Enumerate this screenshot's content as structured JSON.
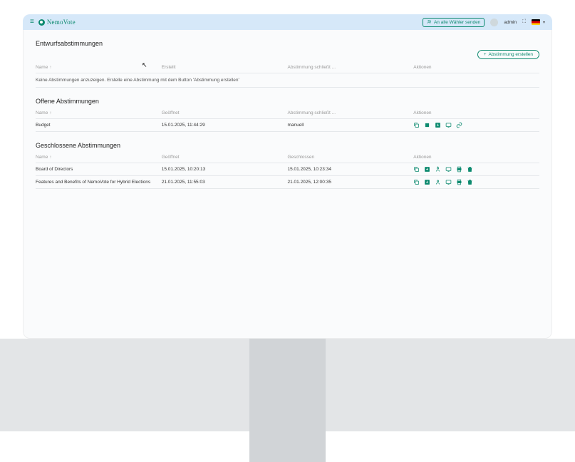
{
  "header": {
    "brand": "NemoVote",
    "broadcast_label": "An alle Wähler senden",
    "admin_label": "admin"
  },
  "cursor": "↖",
  "sections": {
    "drafts": {
      "title": "Entwurfsabstimmungen",
      "create_label": "Abstimmung erstellen",
      "cols": {
        "name": "Name",
        "created": "Erstellt",
        "closes": "Abstimmung schließt ...",
        "actions": "Aktionen"
      },
      "empty": "Keine Abstimmungen anzuzeigen. Erstelle eine Abstimmung mit dem Button 'Abstimmung erstellen'"
    },
    "open": {
      "title": "Offene Abstimmungen",
      "cols": {
        "name": "Name",
        "opened": "Geöffnet",
        "closes": "Abstimmung schließt ...",
        "actions": "Aktionen"
      },
      "rows": [
        {
          "name": "Budget",
          "opened": "15.01.2025, 11:44:29",
          "closes": "manuell"
        }
      ]
    },
    "closed": {
      "title": "Geschlossene Abstimmungen",
      "cols": {
        "name": "Name",
        "opened": "Geöffnet",
        "closed": "Geschlossen",
        "actions": "Aktionen"
      },
      "rows": [
        {
          "name": "Board of Directors",
          "opened": "15.01.2025, 10:20:13",
          "closed": "15.01.2025, 10:23:34"
        },
        {
          "name": "Features and Benefits of NemoVote for Hybrid Elections",
          "opened": "21.01.2025, 11:55:03",
          "closed": "21.01.2025, 12:00:35"
        }
      ]
    }
  },
  "icons": {
    "copy": "copy-icon",
    "stop": "stop-icon",
    "download": "download-icon",
    "screen": "screen-icon",
    "link": "link-icon",
    "user": "user-icon",
    "print": "print-icon",
    "trash": "trash-icon",
    "people": "people-icon",
    "plus": "+"
  }
}
